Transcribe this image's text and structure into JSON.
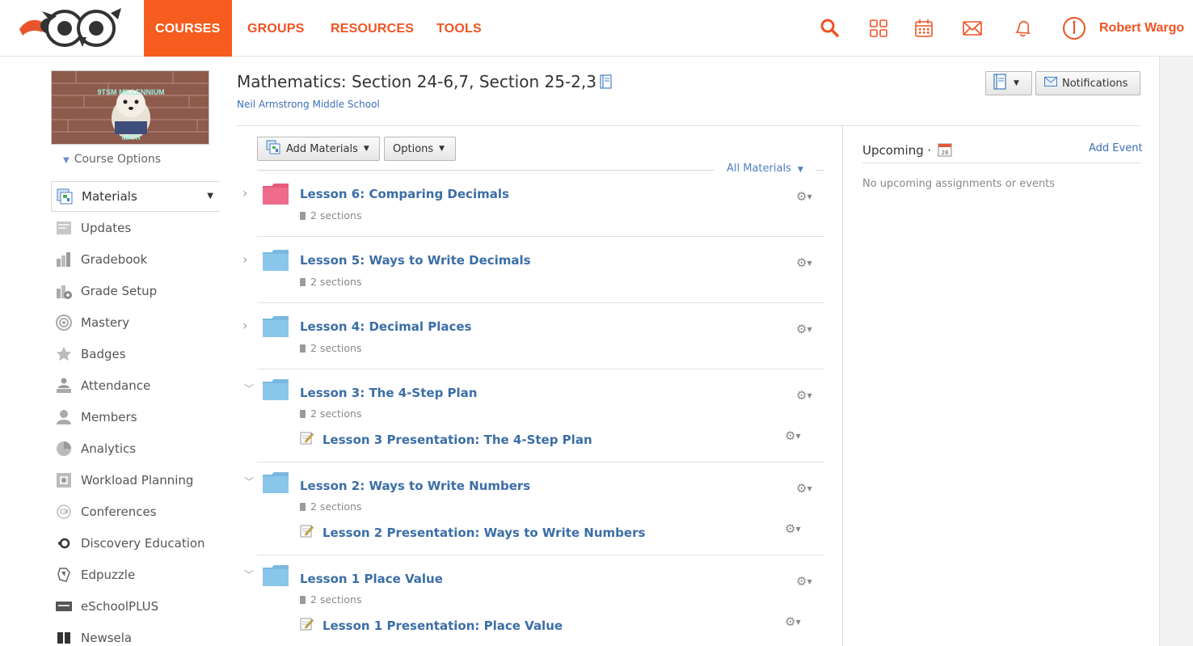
{
  "nav": {
    "courses": "COURSES",
    "groups": "GROUPS",
    "resources": "RESOURCES",
    "tools": "TOOLS",
    "user_name": "Robert Wargo",
    "brand_color": "#f55c1e"
  },
  "sidebar": {
    "course_options": "Course Options",
    "items": [
      {
        "label": "Materials",
        "icon": "materials-icon"
      },
      {
        "label": "Updates",
        "icon": "updates-icon"
      },
      {
        "label": "Gradebook",
        "icon": "gradebook-icon"
      },
      {
        "label": "Grade Setup",
        "icon": "grade-setup-icon"
      },
      {
        "label": "Mastery",
        "icon": "mastery-icon"
      },
      {
        "label": "Badges",
        "icon": "badges-icon"
      },
      {
        "label": "Attendance",
        "icon": "attendance-icon"
      },
      {
        "label": "Members",
        "icon": "members-icon"
      },
      {
        "label": "Analytics",
        "icon": "analytics-icon"
      },
      {
        "label": "Workload Planning",
        "icon": "workload-icon"
      },
      {
        "label": "Conferences",
        "icon": "conferences-icon"
      },
      {
        "label": "Discovery Education",
        "icon": "discovery-icon"
      },
      {
        "label": "Edpuzzle",
        "icon": "edpuzzle-icon"
      },
      {
        "label": "eSchoolPLUS",
        "icon": "eschoolplus-icon"
      },
      {
        "label": "Newsela",
        "icon": "newsela-icon"
      }
    ]
  },
  "header": {
    "title": "Mathematics: Section 24-6,7, Section 25-2,3",
    "school": "Neil Armstrong Middle School",
    "notifications_label": "Notifications"
  },
  "toolbar": {
    "add_materials": "Add Materials",
    "options": "Options",
    "all_materials": "All Materials"
  },
  "folders": [
    {
      "title": "Lesson 6: Comparing Decimals",
      "sections": "2 sections",
      "color": "#e8587a",
      "expanded": false,
      "items": []
    },
    {
      "title": "Lesson 5: Ways to Write Decimals",
      "sections": "2 sections",
      "color": "#7ab8e0",
      "expanded": false,
      "items": []
    },
    {
      "title": "Lesson 4: Decimal Places",
      "sections": "2 sections",
      "color": "#7ab8e0",
      "expanded": false,
      "items": []
    },
    {
      "title": "Lesson 3: The 4-Step Plan",
      "sections": "2 sections",
      "color": "#7ab8e0",
      "expanded": true,
      "items": [
        "Lesson 3 Presentation: The 4-Step Plan"
      ]
    },
    {
      "title": "Lesson 2: Ways to Write Numbers",
      "sections": "2 sections",
      "color": "#7ab8e0",
      "expanded": true,
      "items": [
        "Lesson 2 Presentation: Ways to Write Numbers"
      ]
    },
    {
      "title": "Lesson 1 Place Value",
      "sections": "2 sections",
      "color": "#7ab8e0",
      "expanded": true,
      "items": [
        "Lesson 1 Presentation: Place Value"
      ]
    }
  ],
  "upcoming": {
    "title": "Upcoming ·",
    "calendar_day": "28",
    "add_event": "Add Event",
    "empty_text": "No upcoming assignments or events"
  },
  "course_image": {
    "caption_top": "9TSM MILLENNIUM",
    "caption_bottom": "MATH"
  }
}
